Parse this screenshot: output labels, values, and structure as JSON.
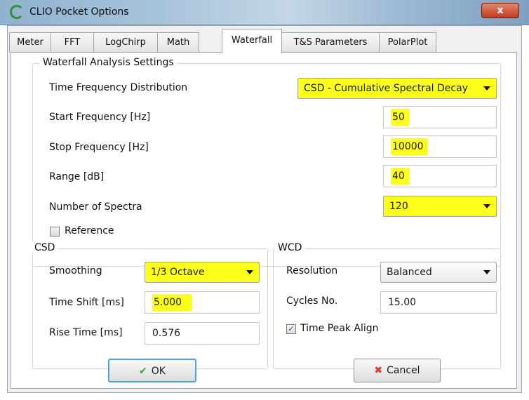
{
  "window": {
    "title": "CLIO Pocket Options",
    "close_label": "x"
  },
  "tabs": [
    {
      "label": "Meter"
    },
    {
      "label": "FFT"
    },
    {
      "label": "LogChirp"
    },
    {
      "label": "Math"
    },
    {
      "label": "Waterfall",
      "active": true
    },
    {
      "label": "T&S Parameters"
    },
    {
      "label": "PolarPlot"
    }
  ],
  "waterfall": {
    "group_title": "Waterfall Analysis Settings",
    "tfd_label": "Time Frequency Distribution",
    "tfd_value": "CSD - Cumulative Spectral Decay",
    "start_label": "Start Frequency [Hz]",
    "start_value": "50",
    "stop_label": "Stop Frequency [Hz]",
    "stop_value": "10000",
    "range_label": "Range [dB]",
    "range_value": "40",
    "spectra_label": "Number of Spectra",
    "spectra_value": "120",
    "reference_label": "Reference",
    "reference_checked": false
  },
  "csd": {
    "group_title": "CSD",
    "smoothing_label": "Smoothing",
    "smoothing_value": "1/3 Octave",
    "timeshift_label": "Time Shift [ms]",
    "timeshift_value": "5.000",
    "risetime_label": "Rise Time [ms]",
    "risetime_value": "0.576"
  },
  "wcd": {
    "group_title": "WCD",
    "resolution_label": "Resolution",
    "resolution_value": "Balanced",
    "cycles_label": "Cycles No.",
    "cycles_value": "15.00",
    "peak_align_label": "Time Peak Align",
    "peak_align_checked": true
  },
  "buttons": {
    "ok_label": "OK",
    "cancel_label": "Cancel"
  },
  "colors": {
    "highlight": "#fcff1a",
    "ok_check": "#3ea33e",
    "cancel_x": "#d9342b",
    "focus_border": "#4aa3df"
  }
}
